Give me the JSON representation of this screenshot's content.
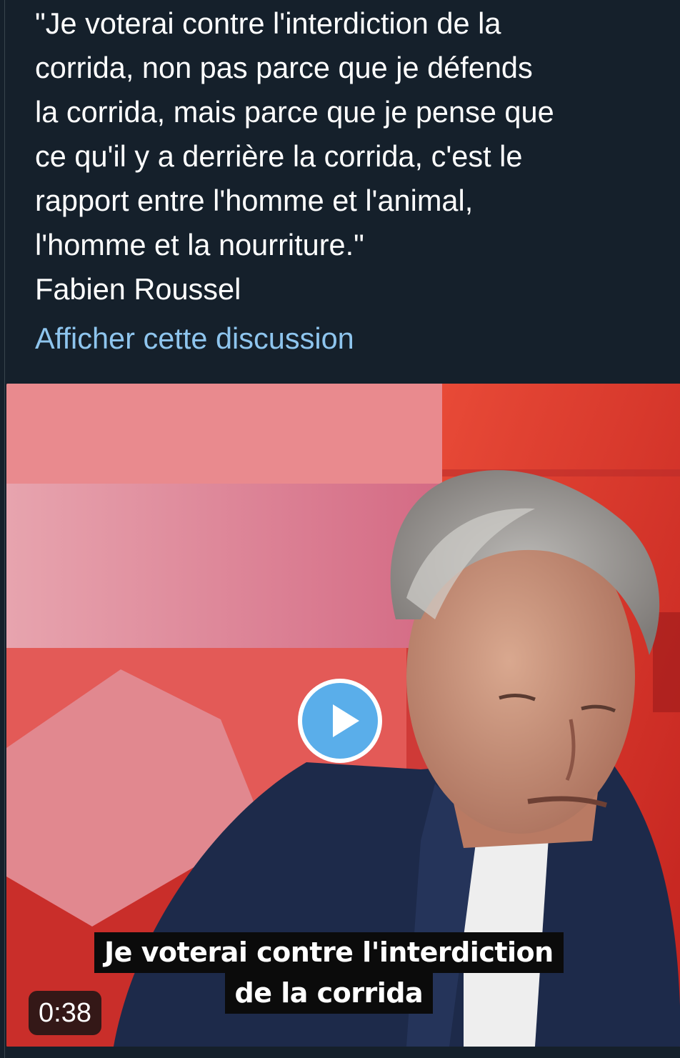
{
  "tweet": {
    "quote_text": "\"Je voterai contre l'interdiction de la\ncorrida, non pas parce que je défends\nla corrida, mais parce que je pense que\nce qu'il y a derrière la corrida, c'est le\nrapport entre l'homme et l'animal,\nl'homme et la nourriture.\"\nFabien Roussel",
    "show_thread_link": "Afficher cette discussion"
  },
  "video": {
    "subtitle_line_1": "Je voterai contre l'interdiction",
    "subtitle_line_2": "de la corrida",
    "duration": "0:38",
    "play_icon": "play-icon"
  },
  "colors": {
    "background": "#15202b",
    "text": "#ffffff",
    "link": "#8ec5ee",
    "play_accent": "#5aaeea"
  }
}
